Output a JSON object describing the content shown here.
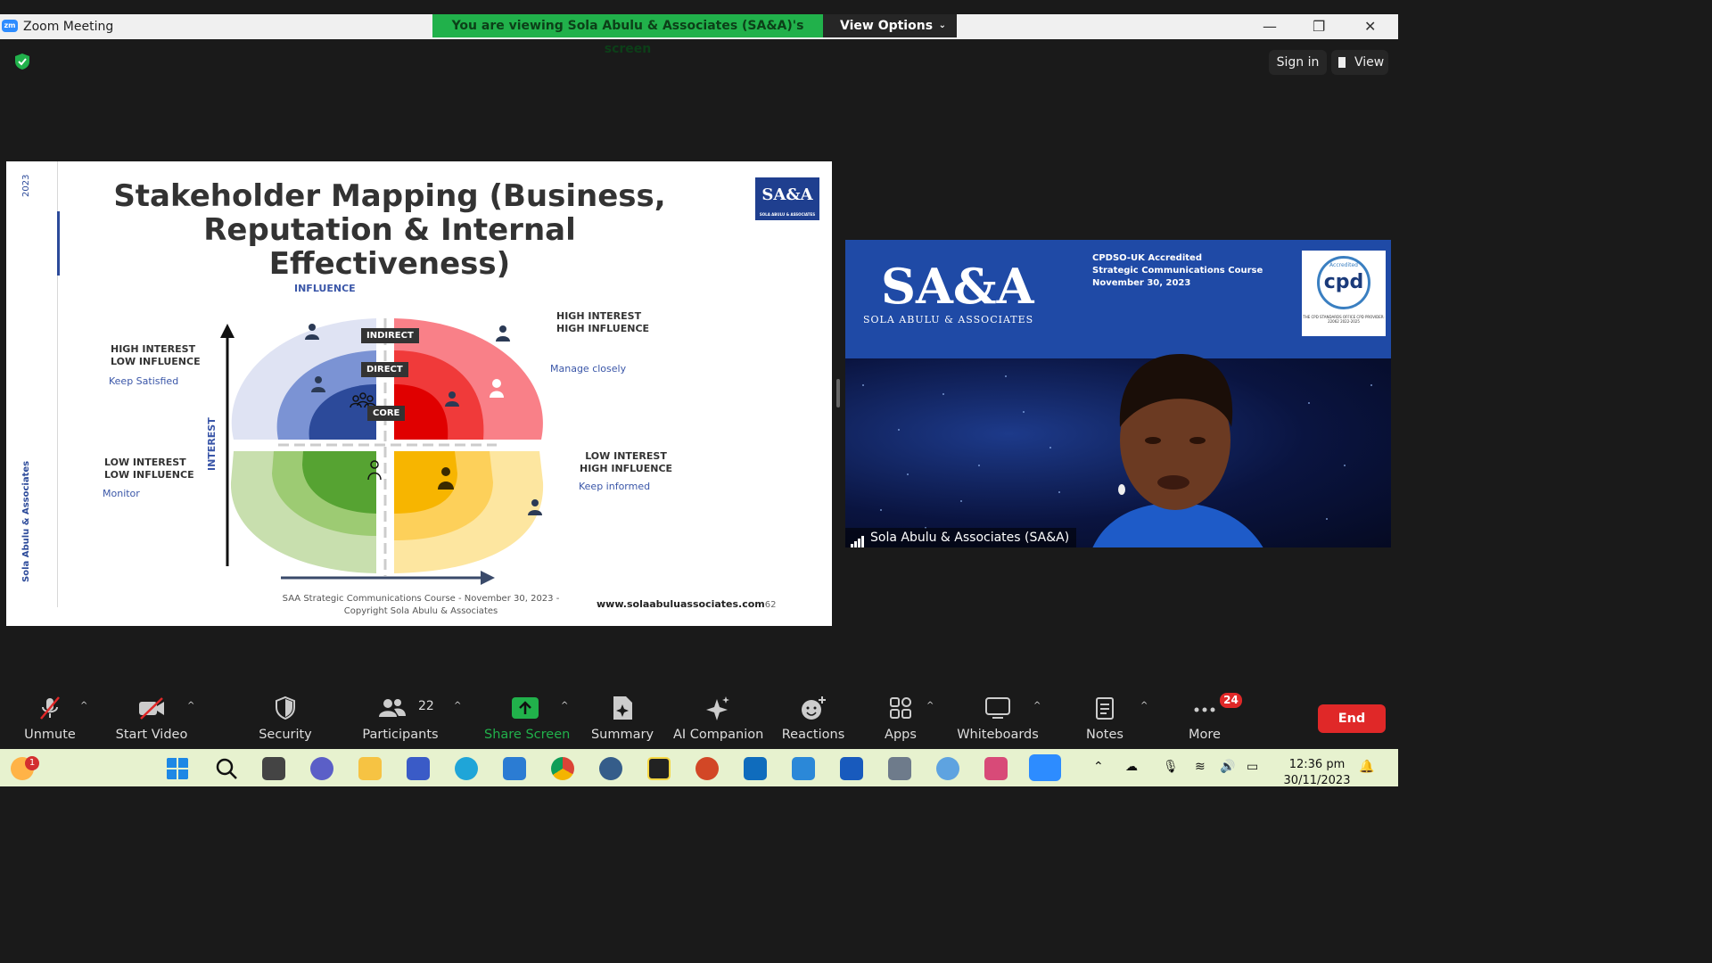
{
  "window": {
    "app_title": "Zoom Meeting",
    "logo_text": "zm",
    "viewing_banner": "You are viewing Sola Abulu & Associates (SA&A)'s screen",
    "view_options_label": "View Options",
    "minimize": "—",
    "restore": "❐",
    "close": "✕"
  },
  "topbar": {
    "sign_in_label": "Sign in",
    "view_label": "View"
  },
  "slide": {
    "year": "2023",
    "vertical_name": "Sola Abulu & Associates",
    "title_line1": "Stakeholder Mapping (Business,",
    "title_line2": "Reputation & Internal Effectiveness)",
    "logo_text": "SA&A",
    "logo_sub": "SOLA ABULU & ASSOCIATES",
    "axis_influence": "INFLUENCE",
    "axis_interest": "INTEREST",
    "quadrants": {
      "hi_lo": {
        "line1": "HIGH INTEREST",
        "line2": "LOW INFLUENCE",
        "action": "Keep Satisfied"
      },
      "hi_hi": {
        "line1": "HIGH INTEREST",
        "line2": "HIGH INFLUENCE",
        "action": "Manage closely"
      },
      "lo_lo": {
        "line1": "LOW INTEREST",
        "line2": "LOW INFLUENCE",
        "action": "Monitor"
      },
      "lo_hi": {
        "line1": "LOW INTEREST",
        "line2": "HIGH INFLUENCE",
        "action": "Keep informed"
      }
    },
    "tags": {
      "indirect": "INDIRECT",
      "direct": "DIRECT",
      "core": "CORE"
    },
    "footer_line1": "SAA Strategic Communications Course - November 30, 2023 -",
    "footer_line2": "Copyright Sola Abulu & Associates",
    "website": "www.solaabuluassociates.com",
    "page_number": "62"
  },
  "video": {
    "brand": "SA&A",
    "brand_sub": "SOLA ABULU & ASSOCIATES",
    "info_line1": "CPDSO-UK Accredited",
    "info_line2": "Strategic Communications Course",
    "info_line3": "November 30, 2023",
    "cpd_label": "cpd",
    "cpd_small": "Accredited",
    "cpd_text": "THE CPD STANDARDS OFFICE CPD PROVIDER: 22062 2022-2025",
    "participant_name": "Sola Abulu & Associates (SA&A)"
  },
  "toolbar": {
    "unmute": "Unmute",
    "start_video": "Start Video",
    "security": "Security",
    "participants": "Participants",
    "participants_count": "22",
    "share_screen": "Share Screen",
    "summary": "Summary",
    "ai_companion": "AI Companion",
    "reactions": "Reactions",
    "apps": "Apps",
    "whiteboards": "Whiteboards",
    "notes": "Notes",
    "more": "More",
    "more_badge": "24",
    "end": "End",
    "caret": "^"
  },
  "taskbar": {
    "weather_badge": "1",
    "time": "12:36 pm",
    "date": "30/11/2023"
  },
  "colors": {
    "zoom_green": "#21b14b",
    "end_red": "#e02828",
    "zoom_blue": "#2d8cff"
  }
}
